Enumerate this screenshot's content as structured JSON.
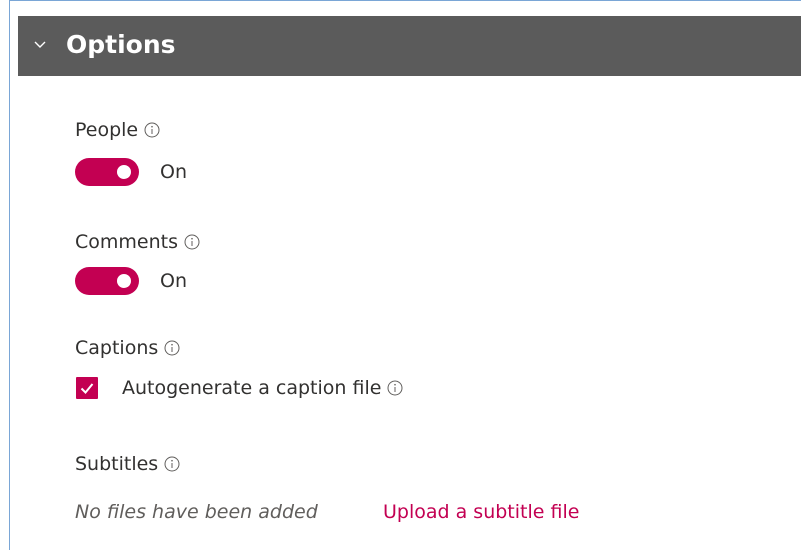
{
  "options_section": {
    "title": "Options",
    "expanded": true
  },
  "people": {
    "label": "People",
    "toggle_state": "On",
    "enabled": true
  },
  "comments": {
    "label": "Comments",
    "toggle_state": "On",
    "enabled": true
  },
  "captions": {
    "label": "Captions",
    "checkbox_label": "Autogenerate a caption file",
    "checked": true
  },
  "subtitles": {
    "label": "Subtitles",
    "empty_text": "No files have been added",
    "upload_link": "Upload a subtitle file"
  },
  "colors": {
    "accent": "#c30052",
    "header_bg": "#5b5b5b",
    "panel_border": "#7aa6d6"
  },
  "icons": {
    "chevron": "chevron-down-icon",
    "info": "info-icon",
    "checkmark": "checkmark-icon"
  }
}
